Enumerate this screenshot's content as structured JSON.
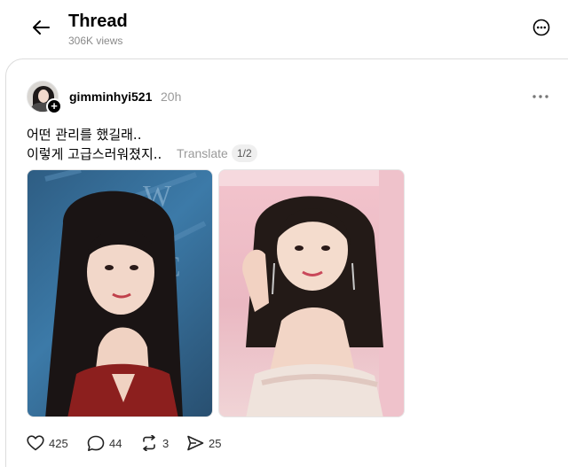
{
  "header": {
    "title": "Thread",
    "views": "306K views"
  },
  "post": {
    "username": "gimminhyi521",
    "time": "20h",
    "text_line1": "어떤 관리를 했길래..",
    "text_line2": "이렇게 고급스러워졌지..",
    "translate_label": "Translate",
    "page_indicator": "1/2",
    "images": [
      {
        "name": "photo-1"
      },
      {
        "name": "photo-2"
      }
    ]
  },
  "actions": {
    "likes": "425",
    "replies": "44",
    "reposts": "3",
    "shares": "25"
  }
}
